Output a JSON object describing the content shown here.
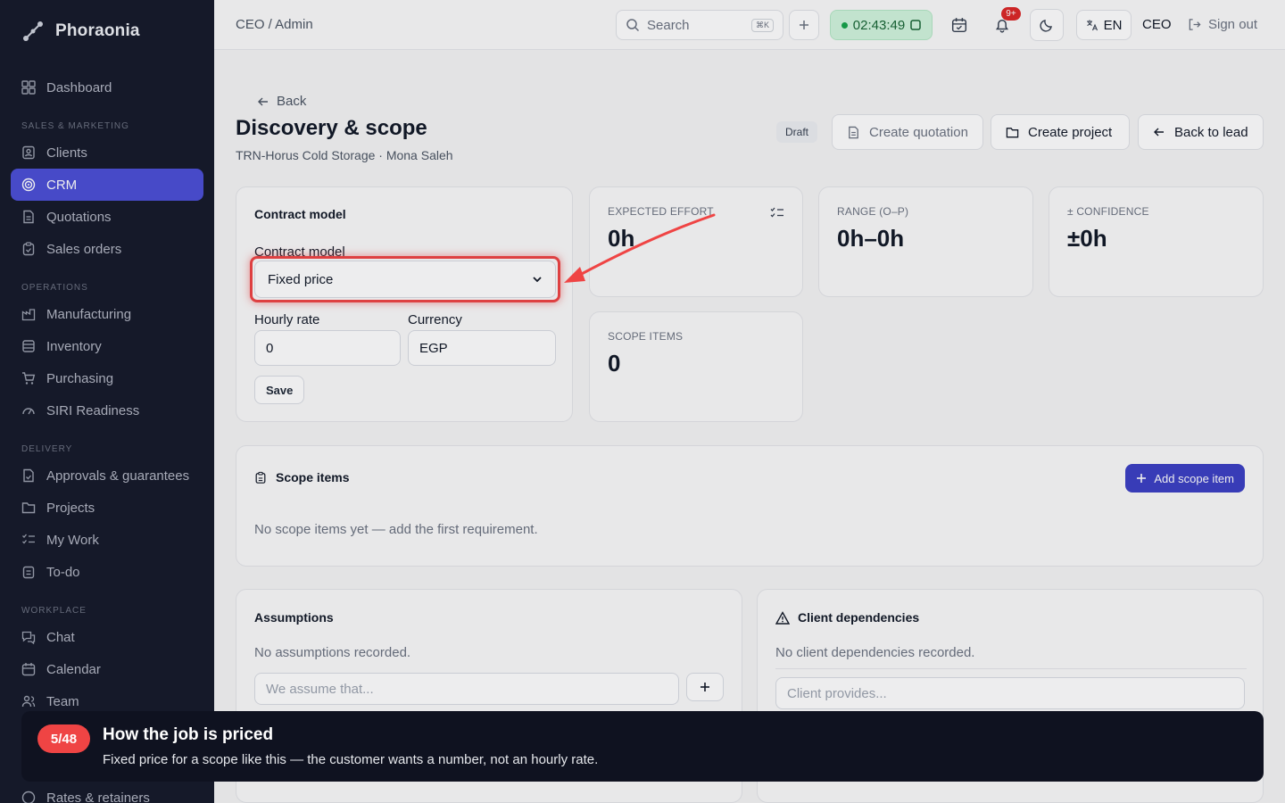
{
  "app": {
    "name": "Phoraonia"
  },
  "sidebar": {
    "items": [
      {
        "label": "Dashboard",
        "icon": "dashboard-icon"
      },
      {
        "label": "Clients",
        "icon": "clients-icon"
      },
      {
        "label": "CRM",
        "icon": "crm-icon",
        "active": true
      },
      {
        "label": "Quotations",
        "icon": "document-icon"
      },
      {
        "label": "Sales orders",
        "icon": "clipboard-icon"
      },
      {
        "label": "Manufacturing",
        "icon": "factory-icon"
      },
      {
        "label": "Inventory",
        "icon": "inventory-icon"
      },
      {
        "label": "Purchasing",
        "icon": "cart-icon"
      },
      {
        "label": "SIRI Readiness",
        "icon": "gauge-icon"
      },
      {
        "label": "Approvals & guarantees",
        "icon": "approval-icon"
      },
      {
        "label": "Projects",
        "icon": "folder-icon"
      },
      {
        "label": "My Work",
        "icon": "list-check-icon"
      },
      {
        "label": "To-do",
        "icon": "todo-icon"
      },
      {
        "label": "Chat",
        "icon": "chat-icon"
      },
      {
        "label": "Calendar",
        "icon": "calendar-icon"
      },
      {
        "label": "Team",
        "icon": "team-icon"
      },
      {
        "label": "Rates & retainers",
        "icon": "rates-icon"
      }
    ],
    "sections": [
      "SALES & MARKETING",
      "OPERATIONS",
      "DELIVERY",
      "WORKPLACE"
    ]
  },
  "topbar": {
    "breadcrumb": "CEO / Admin",
    "search_placeholder": "Search",
    "search_shortcut": "⌘K",
    "timer": "02:43:49",
    "notifications_badge": "9+",
    "language": "EN",
    "role": "CEO",
    "signout": "Sign out"
  },
  "page": {
    "back": "Back",
    "title": "Discovery & scope",
    "subtitle": "TRN-Horus Cold Storage · Mona Saleh",
    "status": "Draft",
    "actions": {
      "create_quotation": "Create quotation",
      "create_project": "Create project",
      "back_to_lead": "Back to lead"
    }
  },
  "contract": {
    "card_title": "Contract model",
    "model_label": "Contract model",
    "model_value": "Fixed price",
    "rate_label": "Hourly rate",
    "rate_value": "0",
    "currency_label": "Currency",
    "currency_value": "EGP",
    "save": "Save"
  },
  "stats": {
    "expected_effort": {
      "label": "EXPECTED EFFORT",
      "value": "0h"
    },
    "range": {
      "label": "RANGE (O–P)",
      "value": "0h–0h"
    },
    "confidence": {
      "label": "± CONFIDENCE",
      "value": "±0h"
    },
    "scope_items": {
      "label": "SCOPE ITEMS",
      "value": "0"
    }
  },
  "scope": {
    "title": "Scope items",
    "add": "Add scope item",
    "empty": "No scope items yet — add the first requirement."
  },
  "assumptions": {
    "title": "Assumptions",
    "empty": "No assumptions recorded.",
    "placeholder": "We assume that..."
  },
  "dependencies": {
    "title": "Client dependencies",
    "empty": "No client dependencies recorded.",
    "placeholder": "Client provides..."
  },
  "tour": {
    "step": "5/48",
    "title": "How the job is priced",
    "text": "Fixed price for a scope like this — the customer wants a number, not an hourly rate."
  },
  "colors": {
    "accent": "#4b4fd6",
    "sidebar_bg": "#151a2a",
    "highlight": "#ef4444",
    "timer_bg": "#d1f5dd"
  }
}
